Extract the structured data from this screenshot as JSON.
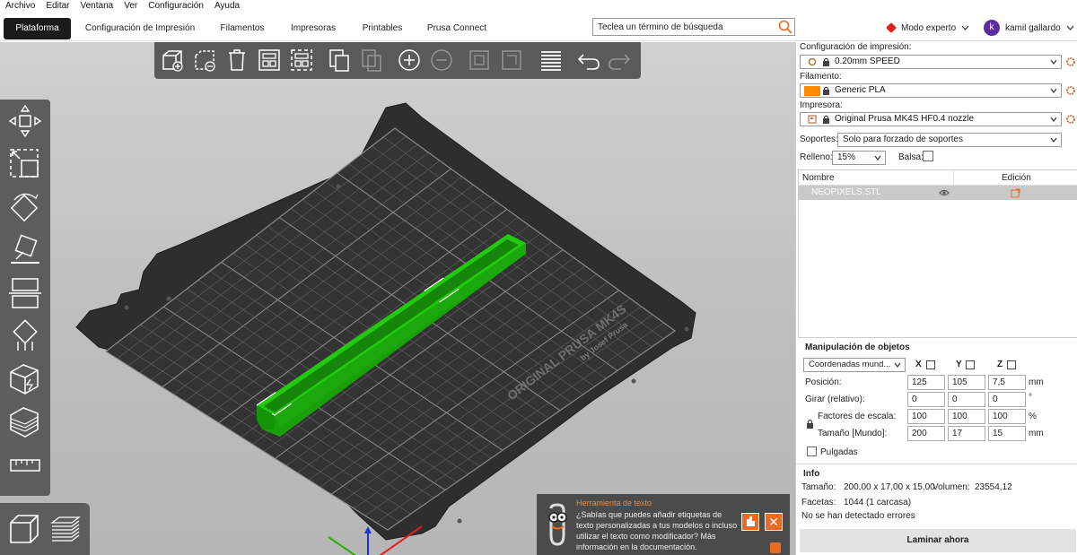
{
  "menu": [
    "Archivo",
    "Editar",
    "Ventana",
    "Ver",
    "Configuración",
    "Ayuda"
  ],
  "tabs": [
    {
      "label": "Plataforma",
      "active": true
    },
    {
      "label": "Configuración de Impresión",
      "active": false
    },
    {
      "label": "Filamentos",
      "active": false
    },
    {
      "label": "Impresoras",
      "active": false
    },
    {
      "label": "Printables",
      "active": false
    },
    {
      "label": "Prusa Connect",
      "active": false
    }
  ],
  "search": {
    "placeholder": "Teclea un término de búsqueda",
    "icon": "search-icon"
  },
  "mode": {
    "label": "Modo experto",
    "color": "#e2231a"
  },
  "user": {
    "initial": "k",
    "name": "kamil gallardo"
  },
  "bed": {
    "brand_line1": "ORIGINAL PRUSA MK4S",
    "brand_line2": "by Josef Prusa",
    "accent": "#ed6b21"
  },
  "object_color": "#1fb80c",
  "notification": {
    "title": "Herramienta de texto",
    "body": "¿Sabías que puedes añadir etiquetas de texto personalizadas a tus modelos o incluso utilizar el texto como modificador? Más información en la documentación."
  },
  "panel": {
    "print_settings_label": "Configuración de impresión:",
    "print_settings_value": "0.20mm SPEED",
    "filament_label": "Filamento:",
    "filament_value": "Generic PLA",
    "filament_color": "#ff8c00",
    "printer_label": "Impresora:",
    "printer_value": "Original Prusa MK4S HF0.4 nozzle",
    "supports_label": "Soportes:",
    "supports_value": "Solo para forzado de soportes",
    "infill_label": "Relleno:",
    "infill_value": "15%",
    "brim_label": "Balsa:",
    "table": {
      "col_name": "Nombre",
      "col_edit": "Edición",
      "object_name": "NEOPIXELS.STL"
    },
    "manip": {
      "title": "Manipulación de objetos",
      "coords": "Coordenadas mund...",
      "x": "X",
      "y": "Y",
      "z": "Z",
      "position_label": "Posición:",
      "position": [
        "125",
        "105",
        "7,5"
      ],
      "position_unit": "mm",
      "rotate_label": "Girar (relativo):",
      "rotate": [
        "0",
        "0",
        "0"
      ],
      "rotate_unit": "°",
      "scale_label": "Factores de escala:",
      "scale": [
        "100",
        "100",
        "100"
      ],
      "scale_unit": "%",
      "size_label": "Tamaño [Mundo]:",
      "size": [
        "200",
        "17",
        "15"
      ],
      "size_unit": "mm",
      "inches_label": "Pulgadas"
    },
    "info": {
      "title": "Info",
      "size_label": "Tamaño:",
      "size_value": "200,00 x 17,00 x 15,00",
      "volume_label": "Volumen:",
      "volume_value": "23554,12",
      "facets_label": "Facetas:",
      "facets_value": "1044 (1 carcasa)",
      "errors": "No se han detectado errores"
    },
    "slice_button": "Laminar ahora"
  }
}
